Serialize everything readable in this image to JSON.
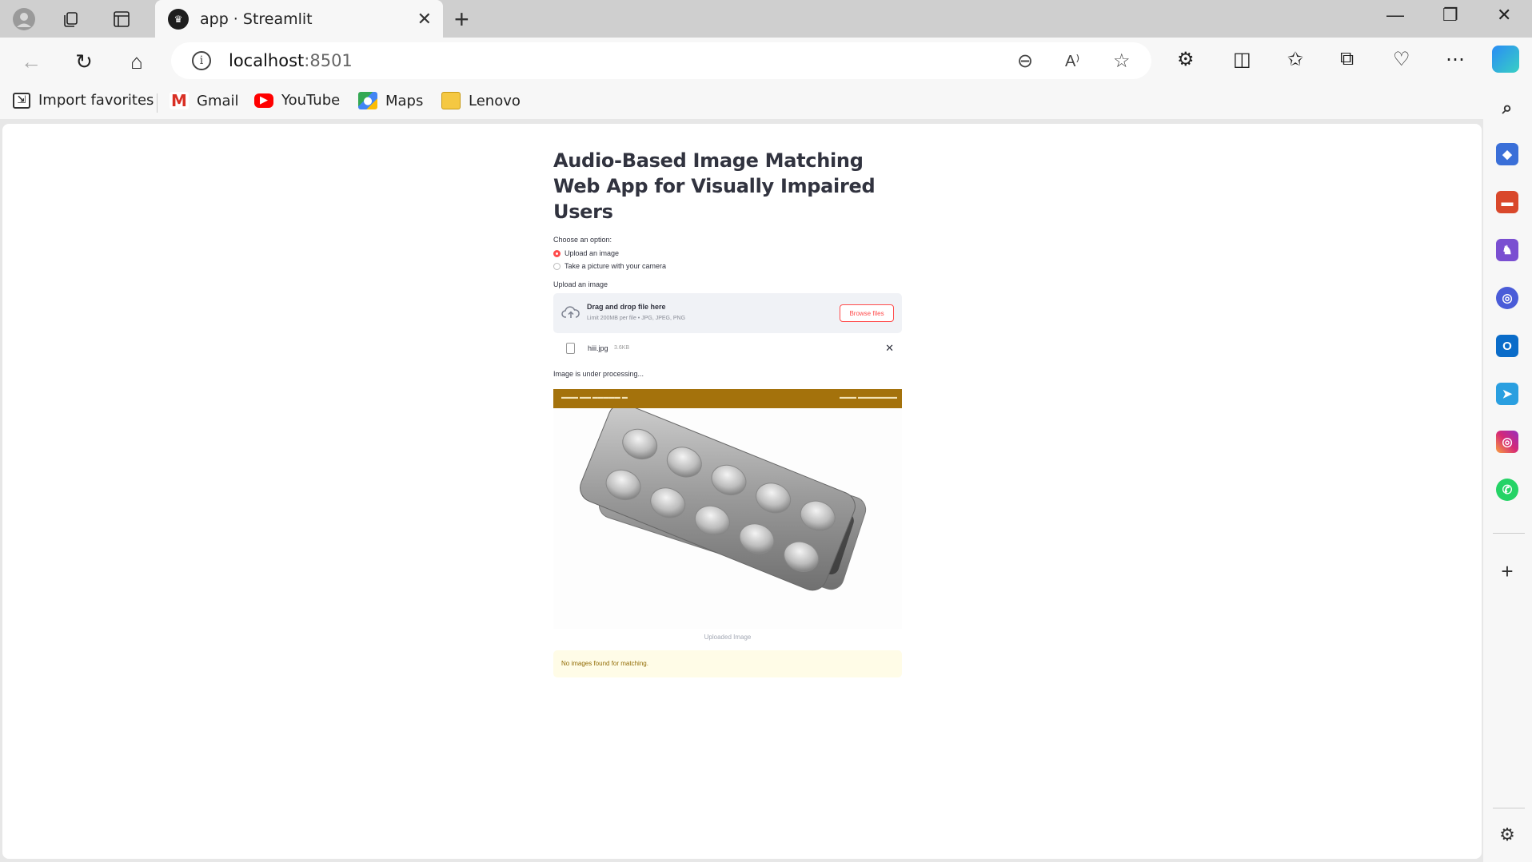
{
  "browser": {
    "tab_title": "app · Streamlit",
    "url_host": "localhost",
    "url_port": ":8501",
    "favorites": [
      {
        "label": "Import favorites",
        "icon": "import-favorites-icon"
      },
      {
        "label": "Gmail",
        "icon": "gmail-icon"
      },
      {
        "label": "YouTube",
        "icon": "youtube-icon"
      },
      {
        "label": "Maps",
        "icon": "maps-icon"
      },
      {
        "label": "Lenovo",
        "icon": "folder-icon"
      }
    ]
  },
  "app": {
    "title": "Audio-Based Image Matching Web App for Visually Impaired Users",
    "option_label": "Choose an option:",
    "options": [
      "Upload an image",
      "Take a picture with your camera"
    ],
    "selected_option": "Upload an image",
    "uploader_label": "Upload an image",
    "dropzone_title": "Drag and drop file here",
    "dropzone_limit": "Limit 200MB per file • JPG, JPEG, PNG",
    "browse_label": "Browse files",
    "file_name": "hiii.jpg",
    "file_size": "3.6KB",
    "processing_text": "Image is under processing...",
    "image_caption": "Uploaded Image",
    "warning_text": "No images found for matching."
  },
  "colors": {
    "accent": "#ff4b4b",
    "warning_bg": "#fffce7",
    "warning_text": "#926c05",
    "dropzone_bg": "#f0f2f6"
  }
}
